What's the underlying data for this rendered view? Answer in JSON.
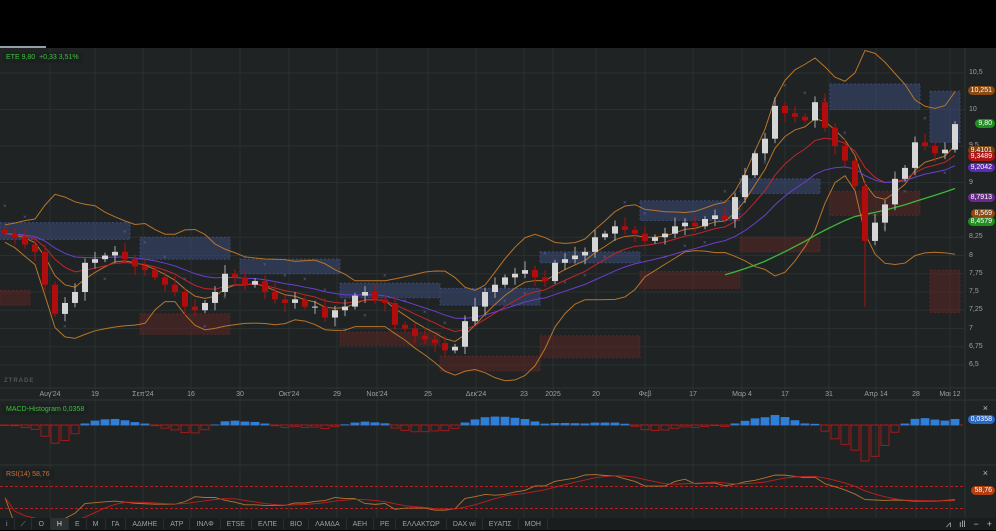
{
  "legend": {
    "symbol": "ETE",
    "price": "9,80",
    "change": "+0,33",
    "change_pct": "3,51%"
  },
  "logo_text": "ZTRADE",
  "price_axis": [
    "10,5",
    "10",
    "9,5",
    "9",
    "8,25",
    "8",
    "7,75",
    "7,5",
    "7,25",
    "7",
    "6,75",
    "6,5"
  ],
  "price_axis_values": [
    10.5,
    10,
    9.5,
    9,
    8.25,
    8,
    7.75,
    7.5,
    7.25,
    7,
    6.75,
    6.5
  ],
  "badges": [
    {
      "label": "10,251",
      "value": 10.251,
      "color": "#8a4a12"
    },
    {
      "label": "9,80",
      "value": 9.8,
      "color": "#1f8f1f"
    },
    {
      "label": "9,4101",
      "value": 9.43,
      "color": "#7a4010"
    },
    {
      "label": "9,3489",
      "value": 9.3489,
      "color": "#b01515"
    },
    {
      "label": "9,2042",
      "value": 9.2042,
      "color": "#5a2ab0"
    },
    {
      "label": "8,7913",
      "value": 8.7913,
      "color": "#6a2a8a"
    },
    {
      "label": "8,569",
      "value": 8.569,
      "color": "#8a4a12"
    },
    {
      "label": "8,4579",
      "value": 8.4579,
      "color": "#1f8f1f"
    }
  ],
  "x_labels": [
    {
      "label": "Αυγ'24",
      "index": 4.5
    },
    {
      "label": "19",
      "index": 9
    },
    {
      "label": "Σεπ'24",
      "index": 13.8
    },
    {
      "label": "16",
      "index": 18.6
    },
    {
      "label": "30",
      "index": 23.5
    },
    {
      "label": "Οκτ'24",
      "index": 28.4
    },
    {
      "label": "29",
      "index": 33.2
    },
    {
      "label": "Νοε'24",
      "index": 37.2
    },
    {
      "label": "25",
      "index": 42.3
    },
    {
      "label": "Δεκ'24",
      "index": 47.1
    },
    {
      "label": "23",
      "index": 51.9
    },
    {
      "label": "2025",
      "index": 54.8
    },
    {
      "label": "20",
      "index": 59.1
    },
    {
      "label": "Φεβ",
      "index": 64
    },
    {
      "label": "17",
      "index": 68.8
    },
    {
      "label": "Μαρ 4",
      "index": 73.7
    },
    {
      "label": "17",
      "index": 78
    },
    {
      "label": "31",
      "index": 82.4
    },
    {
      "label": "Απρ 14",
      "index": 87.1
    },
    {
      "label": "28",
      "index": 91.1
    },
    {
      "label": "Μαι 12",
      "index": 94.5
    }
  ],
  "chart_data": {
    "type": "candlestick",
    "symbol": "ETE",
    "ylim": [
      6.3,
      10.85
    ],
    "closes": [
      8.3,
      8.25,
      8.15,
      8.05,
      7.6,
      7.2,
      7.35,
      7.5,
      7.9,
      7.95,
      8.0,
      8.05,
      7.95,
      7.85,
      7.8,
      7.7,
      7.6,
      7.5,
      7.3,
      7.25,
      7.35,
      7.5,
      7.75,
      7.7,
      7.6,
      7.65,
      7.5,
      7.4,
      7.35,
      7.4,
      7.3,
      7.3,
      7.15,
      7.25,
      7.3,
      7.45,
      7.5,
      7.4,
      7.35,
      7.05,
      7.0,
      6.9,
      6.85,
      6.8,
      6.7,
      6.75,
      7.1,
      7.3,
      7.5,
      7.6,
      7.7,
      7.75,
      7.8,
      7.7,
      7.65,
      7.9,
      7.95,
      8.0,
      8.05,
      8.25,
      8.3,
      8.4,
      8.35,
      8.3,
      8.2,
      8.25,
      8.3,
      8.4,
      8.45,
      8.4,
      8.5,
      8.55,
      8.5,
      8.8,
      9.1,
      9.4,
      9.6,
      10.05,
      9.95,
      9.9,
      9.85,
      10.1,
      9.75,
      9.5,
      9.3,
      8.95,
      8.2,
      8.45,
      8.7,
      9.05,
      9.2,
      9.55,
      9.5,
      9.4,
      9.45,
      9.8
    ],
    "zones": [
      {
        "from": 0,
        "to": 13,
        "low": 8.22,
        "high": 8.45,
        "kind": "supply"
      },
      {
        "from": 0,
        "to": 3,
        "low": 7.32,
        "high": 7.52,
        "kind": "demand"
      },
      {
        "from": 14,
        "to": 23,
        "low": 7.95,
        "high": 8.25,
        "kind": "supply"
      },
      {
        "from": 14,
        "to": 23,
        "low": 6.92,
        "high": 7.2,
        "kind": "demand"
      },
      {
        "from": 24,
        "to": 34,
        "low": 7.75,
        "high": 7.95,
        "kind": "supply"
      },
      {
        "from": 34,
        "to": 44,
        "low": 7.42,
        "high": 7.62,
        "kind": "supply"
      },
      {
        "from": 34,
        "to": 44,
        "low": 6.77,
        "high": 6.95,
        "kind": "demand"
      },
      {
        "from": 44,
        "to": 54,
        "low": 7.32,
        "high": 7.55,
        "kind": "supply"
      },
      {
        "from": 44,
        "to": 54,
        "low": 6.42,
        "high": 6.62,
        "kind": "demand"
      },
      {
        "from": 54,
        "to": 64,
        "low": 6.6,
        "high": 6.9,
        "kind": "demand"
      },
      {
        "from": 54,
        "to": 64,
        "low": 7.9,
        "high": 8.05,
        "kind": "supply"
      },
      {
        "from": 64,
        "to": 74,
        "low": 8.48,
        "high": 8.75,
        "kind": "supply"
      },
      {
        "from": 64,
        "to": 74,
        "low": 7.55,
        "high": 7.78,
        "kind": "demand"
      },
      {
        "from": 74,
        "to": 82,
        "low": 8.85,
        "high": 9.05,
        "kind": "supply"
      },
      {
        "from": 74,
        "to": 82,
        "low": 8.05,
        "high": 8.25,
        "kind": "demand"
      },
      {
        "from": 83,
        "to": 92,
        "low": 10.0,
        "high": 10.35,
        "kind": "supply"
      },
      {
        "from": 83,
        "to": 92,
        "low": 8.55,
        "high": 8.88,
        "kind": "demand"
      },
      {
        "from": 93,
        "to": 96,
        "low": 9.55,
        "high": 10.25,
        "kind": "supply"
      },
      {
        "from": 93,
        "to": 96,
        "low": 7.22,
        "high": 7.8,
        "kind": "demand"
      }
    ]
  },
  "macd": {
    "label": "MACD-Histogram",
    "value": "0,0358",
    "close": "×"
  },
  "rsi": {
    "label": "RSI(14)",
    "value": "58,76",
    "close": "×"
  },
  "toolbar": {
    "info": "i",
    "draw": "⟋",
    "timeframes": [
      "Ο",
      "Η",
      "Ε",
      "Μ"
    ],
    "active_timeframe": "Η",
    "symbols": [
      "ΓΑ",
      "ΑΔΜΗΕ",
      "ΑΤΡ",
      "ΙΝΛΦ",
      "ETSE",
      "ΕΛΠΕ",
      "ΒΙΟ",
      "ΛΑΜΔΑ",
      "ΑΕΗ",
      "ΡΕ",
      "ΕΛΛΑΚΤΩΡ",
      "DAX wi",
      "ΕΥΑΠΣ",
      "ΜΟΗ"
    ],
    "right_icons": {
      "line": "⩘",
      "bars": "ıll",
      "minus": "−",
      "plus": "+"
    }
  },
  "colors": {
    "bg": "#1f2323",
    "up": "#d6d6d6",
    "down": "#b30c0c",
    "bb": "#b8742a",
    "ma_red": "#c0262b",
    "ma_purple": "#6a3fd0",
    "ma_green": "#3cb83c",
    "macd_pos": "#2f7fd8",
    "macd_neg": "#c01818",
    "rsi": "#b8742a"
  }
}
